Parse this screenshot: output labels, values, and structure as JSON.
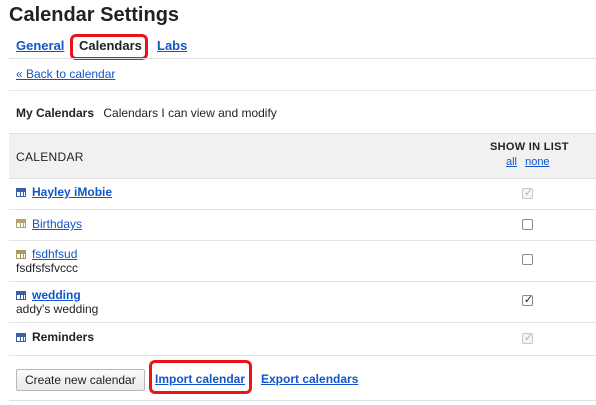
{
  "page": {
    "title": "Calendar Settings"
  },
  "tabs": [
    {
      "label": "General",
      "active": false
    },
    {
      "label": "Calendars",
      "active": true
    },
    {
      "label": "Labs",
      "active": false
    }
  ],
  "back_link": "« Back to calendar",
  "section": {
    "title": "My Calendars",
    "description": "Calendars I can view and modify"
  },
  "table": {
    "col_calendar": "CALENDAR",
    "col_show": "SHOW IN LIST",
    "link_all": "all",
    "link_none": "none",
    "rows": [
      {
        "name": "Hayley iMobie",
        "subtitle": "",
        "checked": true,
        "disabled": true,
        "icon": "calendar-grid-icon",
        "icon_color": "#3b5ea8"
      },
      {
        "name": "Birthdays",
        "subtitle": "",
        "checked": false,
        "disabled": false,
        "icon": "calendar-grid-icon",
        "icon_color": "#b0a36e"
      },
      {
        "name": "fsdhfsud",
        "subtitle": "fsdfsfsfvccc",
        "checked": false,
        "disabled": false,
        "icon": "calendar-grid-icon",
        "icon_color": "#a59a63"
      },
      {
        "name": "wedding",
        "subtitle": "addy's wedding",
        "checked": true,
        "disabled": false,
        "icon": "calendar-grid-icon",
        "icon_color": "#3b5ea8"
      },
      {
        "name": "Reminders",
        "subtitle": "",
        "checked": true,
        "disabled": true,
        "icon": "calendar-grid-icon",
        "icon_color": "#3b5ea8"
      }
    ]
  },
  "actions": {
    "create_label": "Create new calendar",
    "import_label": "Import calendar",
    "export_label": "Export calendars"
  },
  "colors": {
    "link": "#1155cc",
    "highlight": "#e8141a"
  }
}
